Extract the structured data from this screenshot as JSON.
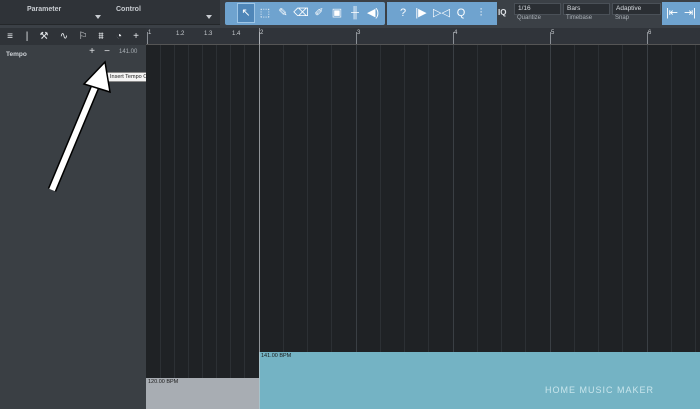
{
  "toolbar": {
    "parameter_label": "Parameter",
    "control_label": "Control",
    "quantize_value": "1/16",
    "quantize_label": "Quantize",
    "timebase_value": "Bars",
    "timebase_label": "Timebase",
    "snap_value": "Adaptive",
    "snap_label": "Snap",
    "iq_label": "IQ"
  },
  "tempo_panel": {
    "label": "Tempo",
    "plus": "+",
    "minus": "−",
    "value": "141.00",
    "tooltip": "Insert Tempo Change"
  },
  "ruler": {
    "ticks": [
      "1",
      "1.2",
      "1.3",
      "1.4",
      "2",
      "3",
      "4",
      "5",
      "6"
    ]
  },
  "blocks": {
    "first_bpm": "120.00 BPM",
    "second_bpm": "141.00 BPM"
  },
  "watermark": "HOME MUSIC MAKER",
  "colors": {
    "accent": "#6fa3cf",
    "tempo_block_1": "#a8adb3",
    "tempo_block_2": "#74b3c4"
  }
}
